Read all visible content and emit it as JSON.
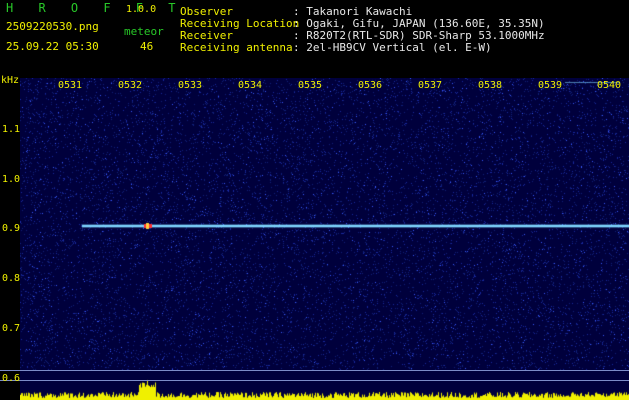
{
  "header": {
    "app_title": "H R O F F T",
    "app_version": "1.0.0",
    "filename": "2509220530.png",
    "datetime": "25.09.22 05:30",
    "meteor_label": "meteor",
    "meteor_count": "46",
    "info_labels": {
      "observer": "Observer",
      "location": "Receiving Location",
      "receiver": "Receiver",
      "antenna": "Receiving antenna"
    },
    "info_values": {
      "observer": ": Takanori Kawachi",
      "location": ": Ogaki, Gifu, JAPAN (136.60E, 35.35N)",
      "receiver": ": R820T2(RTL-SDR) SDR-Sharp 53.1000MHz",
      "antenna": ": 2el-HB9CV Vertical (el. E-W)"
    }
  },
  "axes": {
    "y_unit": "kHz",
    "y_ticks": [
      "1.1",
      "1.0",
      "0.9",
      "0.8",
      "0.7",
      "0.6"
    ],
    "x_ticks": [
      "0531",
      "0532",
      "0533",
      "0534",
      "0535",
      "0536",
      "0537",
      "0538",
      "0539",
      "0540"
    ]
  },
  "signal": {
    "carrier_khz": 0.9,
    "meteor_burst_time": "0532",
    "colors": {
      "background": "#00003c",
      "noise_low": "#1a2aa0",
      "noise_high": "#3a5cff",
      "carrier": "#7fd6ff",
      "burst": "#ff3030",
      "histogram": "#f0f000"
    }
  }
}
